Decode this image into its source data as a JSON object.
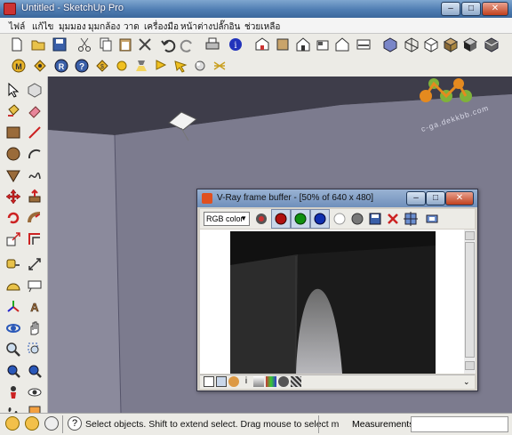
{
  "window": {
    "title": "Untitled - SketchUp Pro",
    "controls": {
      "minimize": "‒",
      "maximize": "□",
      "close": "✕"
    }
  },
  "menu": {
    "items": [
      "ไฟล์",
      "แก้ไข",
      "มุมมอง",
      "มุมกล้อง",
      "วาด",
      "เครื่องมือ",
      "หน้าต่าง",
      "ปลั๊กอิน",
      "ช่วยเหลือ"
    ]
  },
  "vray_frame_buffer": {
    "title": "V-Ray frame buffer - [50% of 640 x 480]",
    "channel_select": "RGB color",
    "controls": {
      "minimize": "‒",
      "maximize": "□",
      "close": "✕"
    }
  },
  "watermark": {
    "text": "c-ga.dekkbb.com"
  },
  "statusbar": {
    "message": "Select objects. Shift to extend select. Drag mouse to select m",
    "measurements_label": "Measurements",
    "help_icon": "?"
  },
  "colors": {
    "title_bar": "#4f7db2",
    "viewport_wall": "#8a889a",
    "viewport_ceiling": "#4a4958",
    "render_bg": "#1b1b1b",
    "watermark_orange": "#e58a1f",
    "watermark_green": "#7fb23a"
  }
}
